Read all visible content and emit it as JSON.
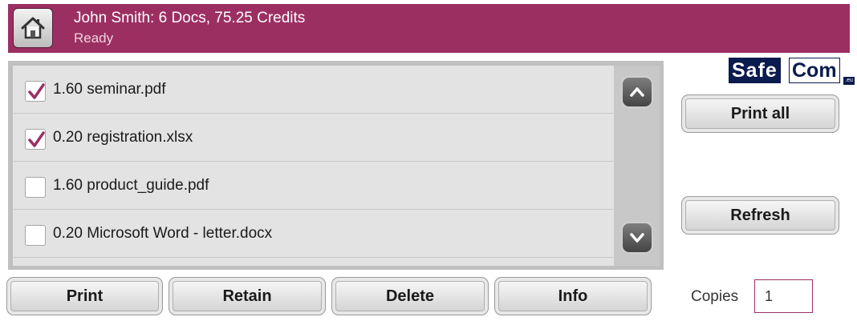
{
  "header": {
    "title": "John Smith: 6 Docs, 75.25 Credits",
    "status": "Ready",
    "home_icon": "home-icon"
  },
  "documents": [
    {
      "label": "1.60 seminar.pdf",
      "checked": true
    },
    {
      "label": "0.20 registration.xlsx",
      "checked": true
    },
    {
      "label": "1.60 product_guide.pdf",
      "checked": false
    },
    {
      "label": "0.20 Microsoft Word - letter.docx",
      "checked": false
    }
  ],
  "scroll": {
    "up_icon": "chevron-up-icon",
    "down_icon": "chevron-down-icon"
  },
  "logo": {
    "safe": "Safe",
    "com": "Com",
    "eu": ".eu"
  },
  "side_buttons": {
    "print_all": "Print all",
    "refresh": "Refresh"
  },
  "bottom_buttons": {
    "print": "Print",
    "retain": "Retain",
    "delete": "Delete",
    "info": "Info"
  },
  "copies": {
    "label": "Copies",
    "value": "1"
  },
  "colors": {
    "header_bg": "#9c2f62",
    "check_mark": "#9c2f62",
    "logo_navy": "#0b1a4f"
  }
}
